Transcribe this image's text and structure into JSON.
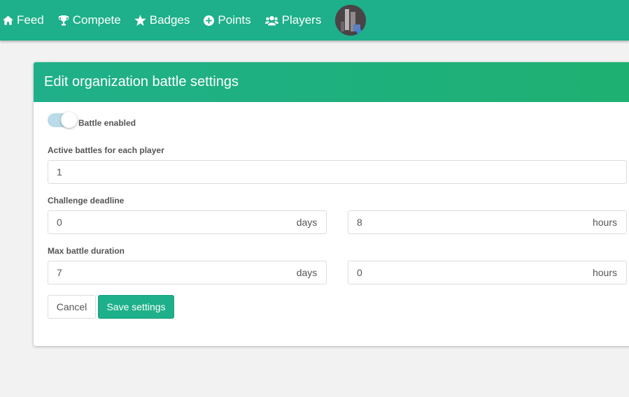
{
  "nav": {
    "items": [
      {
        "label": "Feed",
        "icon": "home-icon"
      },
      {
        "label": "Compete",
        "icon": "trophy-icon"
      },
      {
        "label": "Badges",
        "icon": "star-icon"
      },
      {
        "label": "Points",
        "icon": "plus-circle-icon"
      },
      {
        "label": "Players",
        "icon": "users-icon"
      }
    ]
  },
  "colors": {
    "accent": "#1db08a",
    "toggle_track": "#b9dce8"
  },
  "card": {
    "title": "Edit organization battle settings"
  },
  "form": {
    "battle_enabled": {
      "label": "Battle enabled",
      "on": true
    },
    "active_battles": {
      "label": "Active battles for each player",
      "value": "1"
    },
    "challenge_deadline": {
      "label": "Challenge deadline",
      "days": "0",
      "hours": "8",
      "days_unit": "days",
      "hours_unit": "hours"
    },
    "max_duration": {
      "label": "Max battle duration",
      "days": "7",
      "hours": "0",
      "days_unit": "days",
      "hours_unit": "hours"
    }
  },
  "buttons": {
    "cancel": "Cancel",
    "save": "Save settings"
  }
}
